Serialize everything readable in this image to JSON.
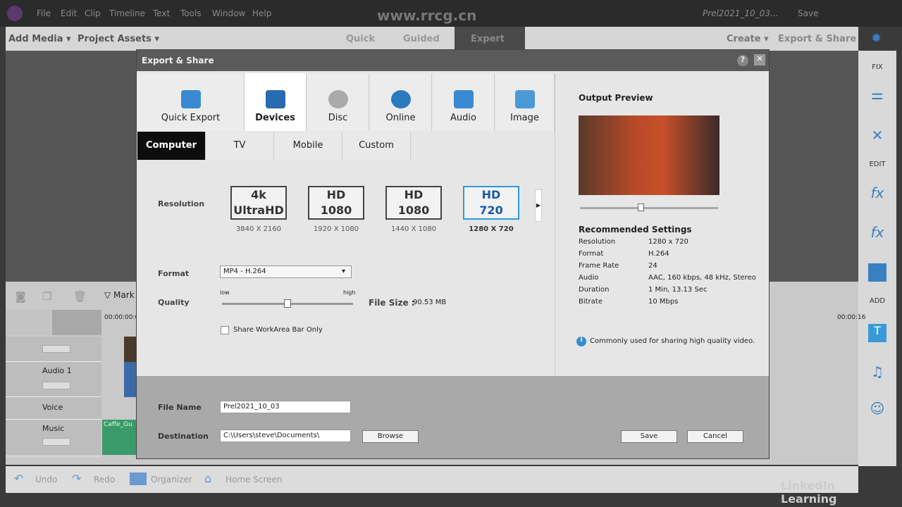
{
  "menu": [
    "File",
    "Edit",
    "Clip",
    "Timeline",
    "Text",
    "Tools",
    "Window",
    "Help"
  ],
  "project_name": "Prel2021_10_03...",
  "save_label": "Save",
  "toolbar": {
    "add_media": "Add Media",
    "project_assets": "Project Assets",
    "modes": [
      "Quick",
      "Guided",
      "Expert"
    ],
    "active_mode": "Expert",
    "create": "Create",
    "export_share": "Export & Share"
  },
  "right_panel": {
    "fix": "FIX",
    "edit": "EDIT",
    "add": "ADD"
  },
  "timeline": {
    "marker": "Mark",
    "timecode": "00:00:00:0",
    "timecode_right": "00:00:16",
    "tracks": [
      "Audio 1",
      "Voice",
      "Music"
    ],
    "clip": "Caffe_Gu"
  },
  "bottom": {
    "undo": "Undo",
    "redo": "Redo",
    "organizer": "Organizer",
    "home": "Home Screen"
  },
  "watermark": "www.rrcg.cn",
  "linkedin": "LinkedIn Learning",
  "dialog": {
    "title": "Export & Share",
    "help": "?",
    "close": "✕",
    "tabs": [
      "Quick Export",
      "Devices",
      "Disc",
      "Online",
      "Audio",
      "Image"
    ],
    "active_tab": "Devices",
    "subtabs": [
      "Computer",
      "TV",
      "Mobile",
      "Custom"
    ],
    "active_subtab": "Computer",
    "resolution_label": "Resolution",
    "resolutions": [
      {
        "l1": "4k",
        "l2": "UltraHD",
        "caption": "3840 X 2160"
      },
      {
        "l1": "HD",
        "l2": "1080",
        "caption": "1920 X 1080"
      },
      {
        "l1": "HD",
        "l2": "1080",
        "caption": "1440 X 1080"
      },
      {
        "l1": "HD",
        "l2": "720",
        "caption": "1280 X 720"
      }
    ],
    "selected_resolution": "1280 X 720",
    "format_label": "Format",
    "format_value": "MP4 - H.264",
    "quality_label": "Quality",
    "quality_low": "low",
    "quality_high": "high",
    "quality_level": 0.5,
    "filesize_label": "File Size :",
    "filesize_value": "90.53 MB",
    "workarea_label": "Share WorkArea Bar Only",
    "workarea_checked": false,
    "output_preview": "Output Preview",
    "recommended": "Recommended Settings",
    "settings": [
      [
        "Resolution",
        "1280 x 720"
      ],
      [
        "Format",
        "H.264"
      ],
      [
        "Frame Rate",
        "24"
      ],
      [
        "Audio",
        "AAC, 160 kbps, 48 kHz, Stereo"
      ],
      [
        "Duration",
        "1 Min, 13.13 Sec"
      ],
      [
        "Bitrate",
        "10 Mbps"
      ]
    ],
    "info": "Commonly used for sharing high quality video.",
    "filename_label": "File Name",
    "filename_value": "Prel2021_10_03",
    "destination_label": "Destination",
    "destination_value": "C:\\Users\\steve\\Documents\\",
    "browse": "Browse",
    "save": "Save",
    "cancel": "Cancel"
  },
  "colors": {
    "accent": "#2a9be0",
    "selected_tab": "#0d0d0d"
  }
}
